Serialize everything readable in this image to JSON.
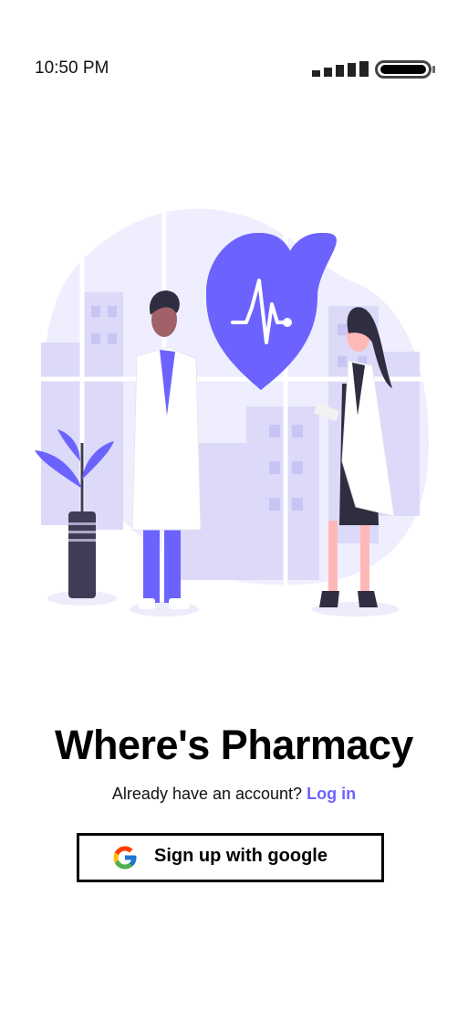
{
  "status_bar": {
    "time": "10:50 PM",
    "signal_icon": "signal-bars-icon",
    "battery_icon": "battery-icon"
  },
  "hero": {
    "illustration": "doctors-heart-illustration"
  },
  "title": "Where's Pharmacy",
  "account_prompt": {
    "text": "Already have an account?",
    "link_label": "Log in"
  },
  "signup": {
    "label": "Sign up with google",
    "icon": "google-icon"
  },
  "colors": {
    "accent": "#6c63ff",
    "text": "#000000",
    "background": "#ffffff"
  }
}
